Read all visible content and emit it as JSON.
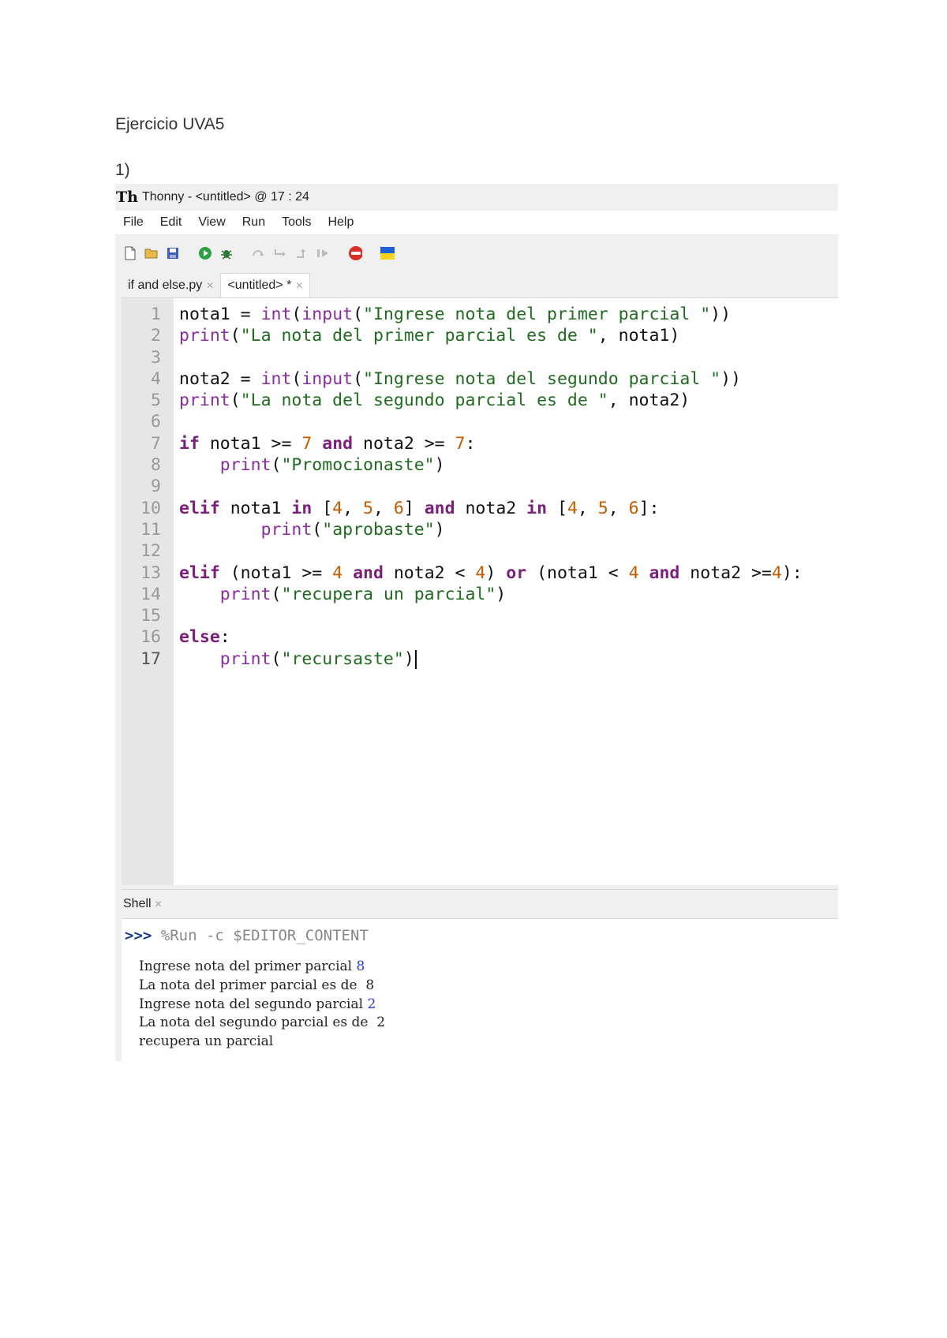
{
  "document": {
    "title": "Ejercicio UVA5",
    "step": "1)"
  },
  "window": {
    "title": "Thonny  -  <untitled>  @  17 : 24"
  },
  "menu": [
    "File",
    "Edit",
    "View",
    "Run",
    "Tools",
    "Help"
  ],
  "tabs": [
    {
      "label": "if and else.py",
      "active": false
    },
    {
      "label": "<untitled> *",
      "active": true
    }
  ],
  "code_lines": [
    "nota1 = int(input(\"Ingrese nota del primer parcial \"))",
    "print(\"La nota del primer parcial es de \", nota1)",
    "",
    "nota2 = int(input(\"Ingrese nota del segundo parcial \"))",
    "print(\"La nota del segundo parcial es de \", nota2)",
    "",
    "if nota1 >= 7 and nota2 >= 7:",
    "    print(\"Promocionaste\")",
    "",
    "elif nota1 in [4, 5, 6] and nota2 in [4, 5, 6]:",
    "        print(\"aprobaste\")",
    "",
    "elif (nota1 >= 4 and nota2 < 4) or (nota1 < 4 and nota2 >=4):",
    "    print(\"recupera un parcial\")",
    "",
    "else:",
    "    print(\"recursaste\")"
  ],
  "shell": {
    "tab_label": "Shell",
    "prompt": ">>>",
    "command": "%Run -c $EDITOR_CONTENT",
    "output": [
      {
        "text": "Ingrese nota del primer parcial ",
        "input": "8"
      },
      {
        "text": "La nota del primer parcial es de  8",
        "input": ""
      },
      {
        "text": "Ingrese nota del segundo parcial ",
        "input": "2"
      },
      {
        "text": "La nota del segundo parcial es de  2",
        "input": ""
      },
      {
        "text": "recupera un parcial",
        "input": ""
      }
    ]
  },
  "colors": {
    "keyword": "#7a1f7a",
    "builtin": "#8a2b9e",
    "string": "#1f6b1f",
    "number": "#c75b00",
    "shell_input": "#2a3fd8"
  }
}
